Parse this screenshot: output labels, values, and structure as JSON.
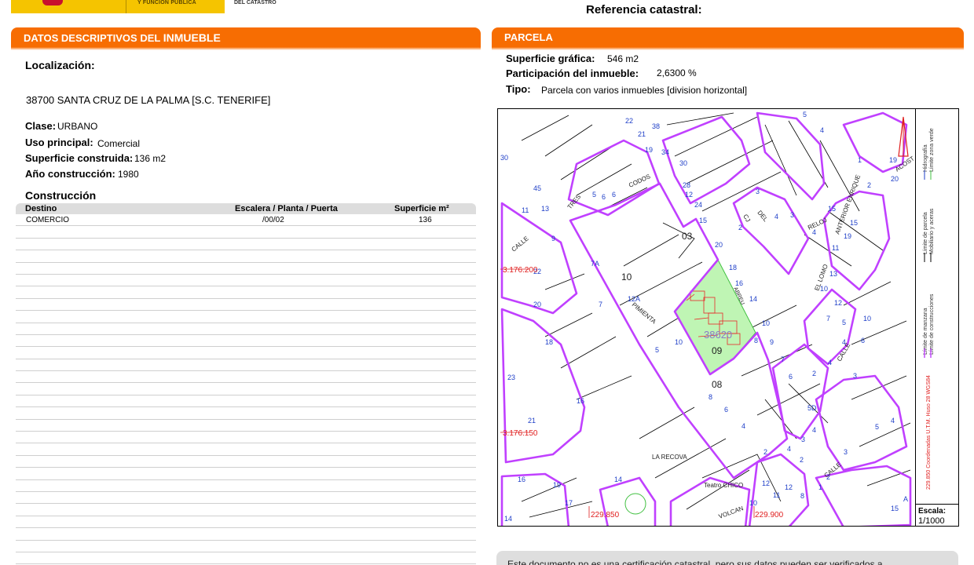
{
  "header": {
    "gov_text": "Y FUNCIÓN PÚBLICA",
    "catastro_text": "DEL CATASTRO",
    "ref_label": "Referencia catastral:"
  },
  "left_section": {
    "title_part1": "DATOS DESCRIPTIVOS DEL ",
    "title_part2": "INMUEBLE",
    "localizacion_label": "Localización:",
    "address": "38700 SANTA CRUZ DE LA PALMA [S.C. TENERIFE]",
    "clase_label": "Clase:",
    "clase_value": "URBANO",
    "uso_label": "Uso principal:",
    "uso_value": "Comercial",
    "superficie_label": "Superficie construida:",
    "superficie_value": "136 m2",
    "anio_label": "Año construcción:",
    "anio_value": "1980",
    "construccion_title": "Construcción",
    "table": {
      "headers": [
        "Destino",
        "Escalera / Planta / Puerta",
        "Superficie m²"
      ],
      "rows": [
        [
          "COMERCIO",
          "/00/02",
          "136"
        ]
      ]
    }
  },
  "right_section": {
    "title": "PARCELA",
    "sup_grafica_label": "Superficie gráfica:",
    "sup_grafica_value": "546 m2",
    "participacion_label": "Participación del inmueble:",
    "participacion_value": "2,6300 %",
    "tipo_label": "Tipo:",
    "tipo_value": "Parcela con varios inmuebles [division horizontal]"
  },
  "map": {
    "parcel_label": "38620",
    "lot_numbers": [
      "03",
      "10",
      "09",
      "08"
    ],
    "street_labels": [
      "LA RECOVA",
      "Teatro CHICO",
      "PIMIENTA",
      "CALLE",
      "TRES",
      "CODOS",
      "DEL",
      "RELOJ",
      "ANTERIOR ENRIQUE",
      "EL LOMO",
      "VOLCAN",
      "ACOST",
      "CJ",
      "ABREU"
    ],
    "coord_labels": [
      "3.176.200",
      "3.176.150",
      "229.850",
      "229.900"
    ],
    "scale_label": "Escala:",
    "scale_value": "1/1000",
    "legend": [
      "Límite de manzana",
      "Límite de construcciones",
      "Límite de parcela",
      "Mobiliario y aceras",
      "Hidrografía",
      "Límite zona verde"
    ],
    "coord_system": "229.850 Coordenadas U.T.M. Huso 28 WGS84",
    "colors": {
      "manzana": "#c040ff",
      "parcel_fill": "#bff5b4",
      "construction": "#e82828",
      "numbers": "#1f3fc8",
      "coords": "#e02020"
    }
  },
  "footer_note": "Este documento no es una certificación catastral, pero sus datos pueden ser verificados a"
}
